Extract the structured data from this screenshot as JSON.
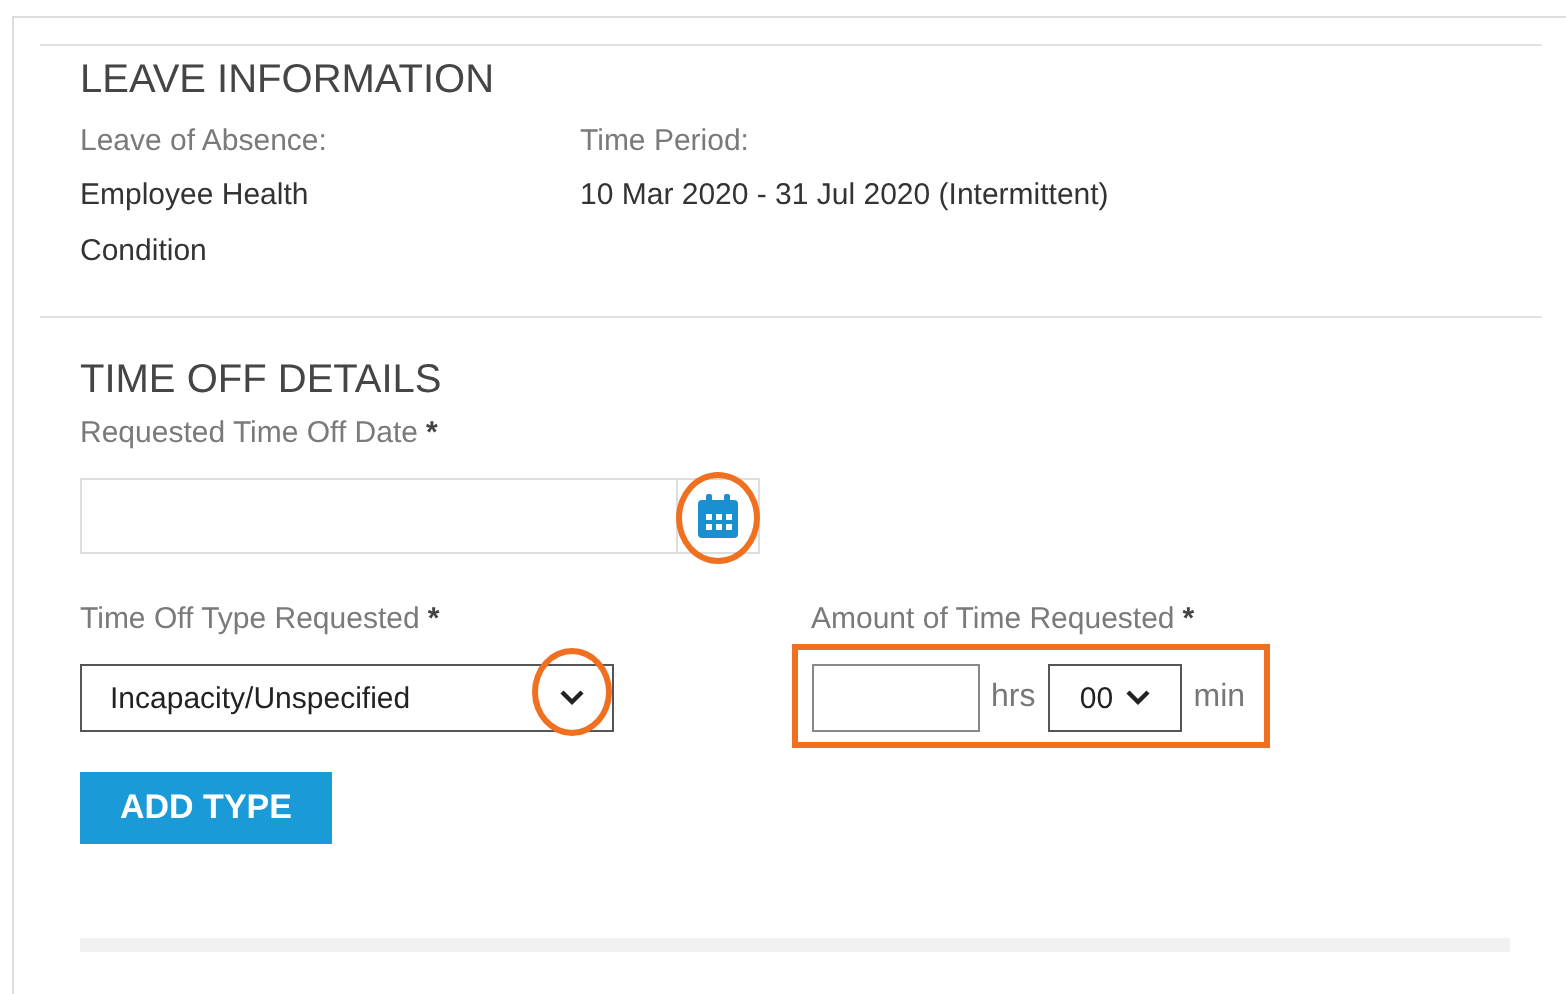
{
  "leave_information": {
    "heading": "LEAVE INFORMATION",
    "fields": [
      {
        "label": "Leave of Absence:",
        "value": "Employee Health Condition"
      },
      {
        "label": "Time Period:",
        "value": "10 Mar 2020 - 31 Jul 2020 (Intermittent)"
      }
    ]
  },
  "time_off_details": {
    "heading": "TIME OFF DETAILS",
    "date_field": {
      "label": "Requested Time Off Date",
      "required_mark": "*",
      "highlighted": true
    },
    "type_field": {
      "label": "Time Off Type Requested",
      "required_mark": "*",
      "value": "Incapacity/Unspecified",
      "highlighted": true
    },
    "amount_field": {
      "label": "Amount of Time Requested",
      "required_mark": "*",
      "hours_unit": "hrs",
      "minutes_value": "00",
      "minutes_unit": "min",
      "highlighted": true
    },
    "add_button": "ADD TYPE"
  }
}
